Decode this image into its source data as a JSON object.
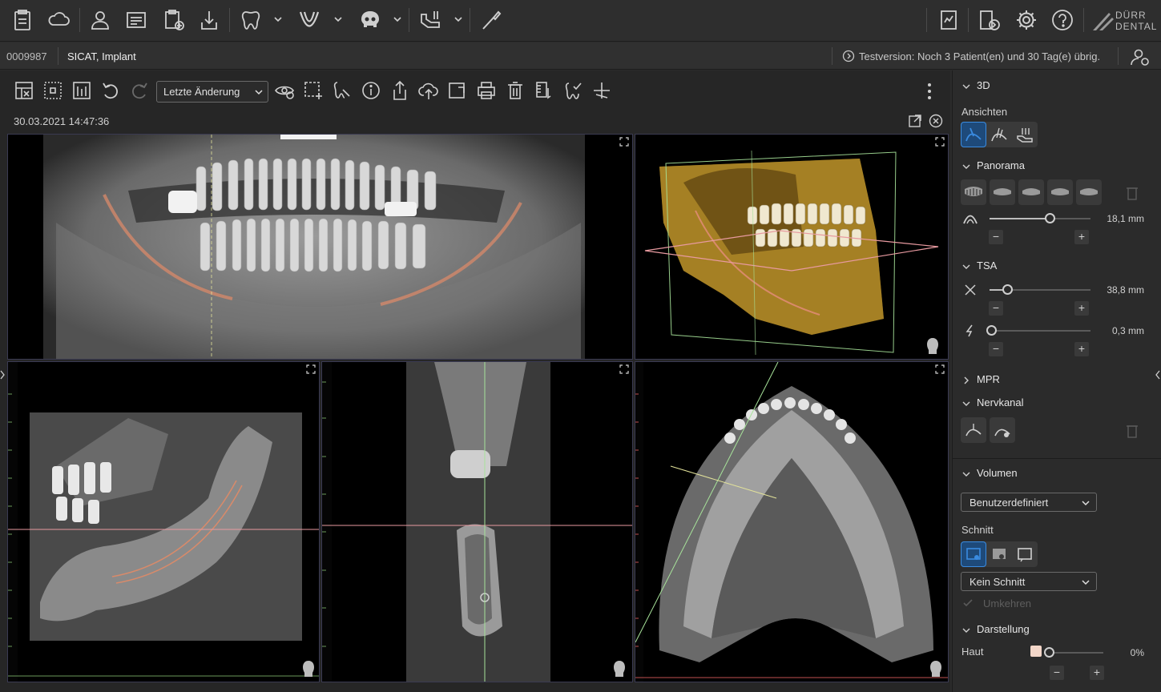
{
  "topbar": {
    "logo_text": [
      "DÜRR",
      "DENTAL"
    ]
  },
  "patient": {
    "id": "0009987",
    "name": "SICAT, Implant",
    "trial_notice": "Testversion: Noch 3 Patient(en) und 30 Tag(e) übrig."
  },
  "viewer": {
    "history_select": "Letzte Änderung",
    "timestamp": "30.03.2021 14:47:36"
  },
  "panel": {
    "section_3d": "3D",
    "ansichten_label": "Ansichten",
    "section_panorama": "Panorama",
    "panorama_thickness": "18,1 mm",
    "panorama_thickness_level": 0.6,
    "section_tsa": "TSA",
    "tsa_value_1": "38,8 mm",
    "tsa_level_1": 0.18,
    "tsa_value_2": "0,3 mm",
    "tsa_level_2": 0.02,
    "section_mpr": "MPR",
    "section_nervkanal": "Nervkanal",
    "section_volumen": "Volumen",
    "volumen_select": "Benutzerdefiniert",
    "schnitt_label": "Schnitt",
    "schnitt_select": "Kein Schnitt",
    "umkehren_label": "Umkehren",
    "section_darstellung": "Darstellung",
    "haut_label": "Haut",
    "haut_value": "0%",
    "haut_level": 0.0
  },
  "colors": {
    "accent_blue": "#3a8be0",
    "nerve_orange": "#d98a6a",
    "crosshair_green": "#a7e39a",
    "crosshair_pink": "#e89aa0",
    "crosshair_yellow": "#e3e39a",
    "bone_gold": "#b8902c"
  }
}
